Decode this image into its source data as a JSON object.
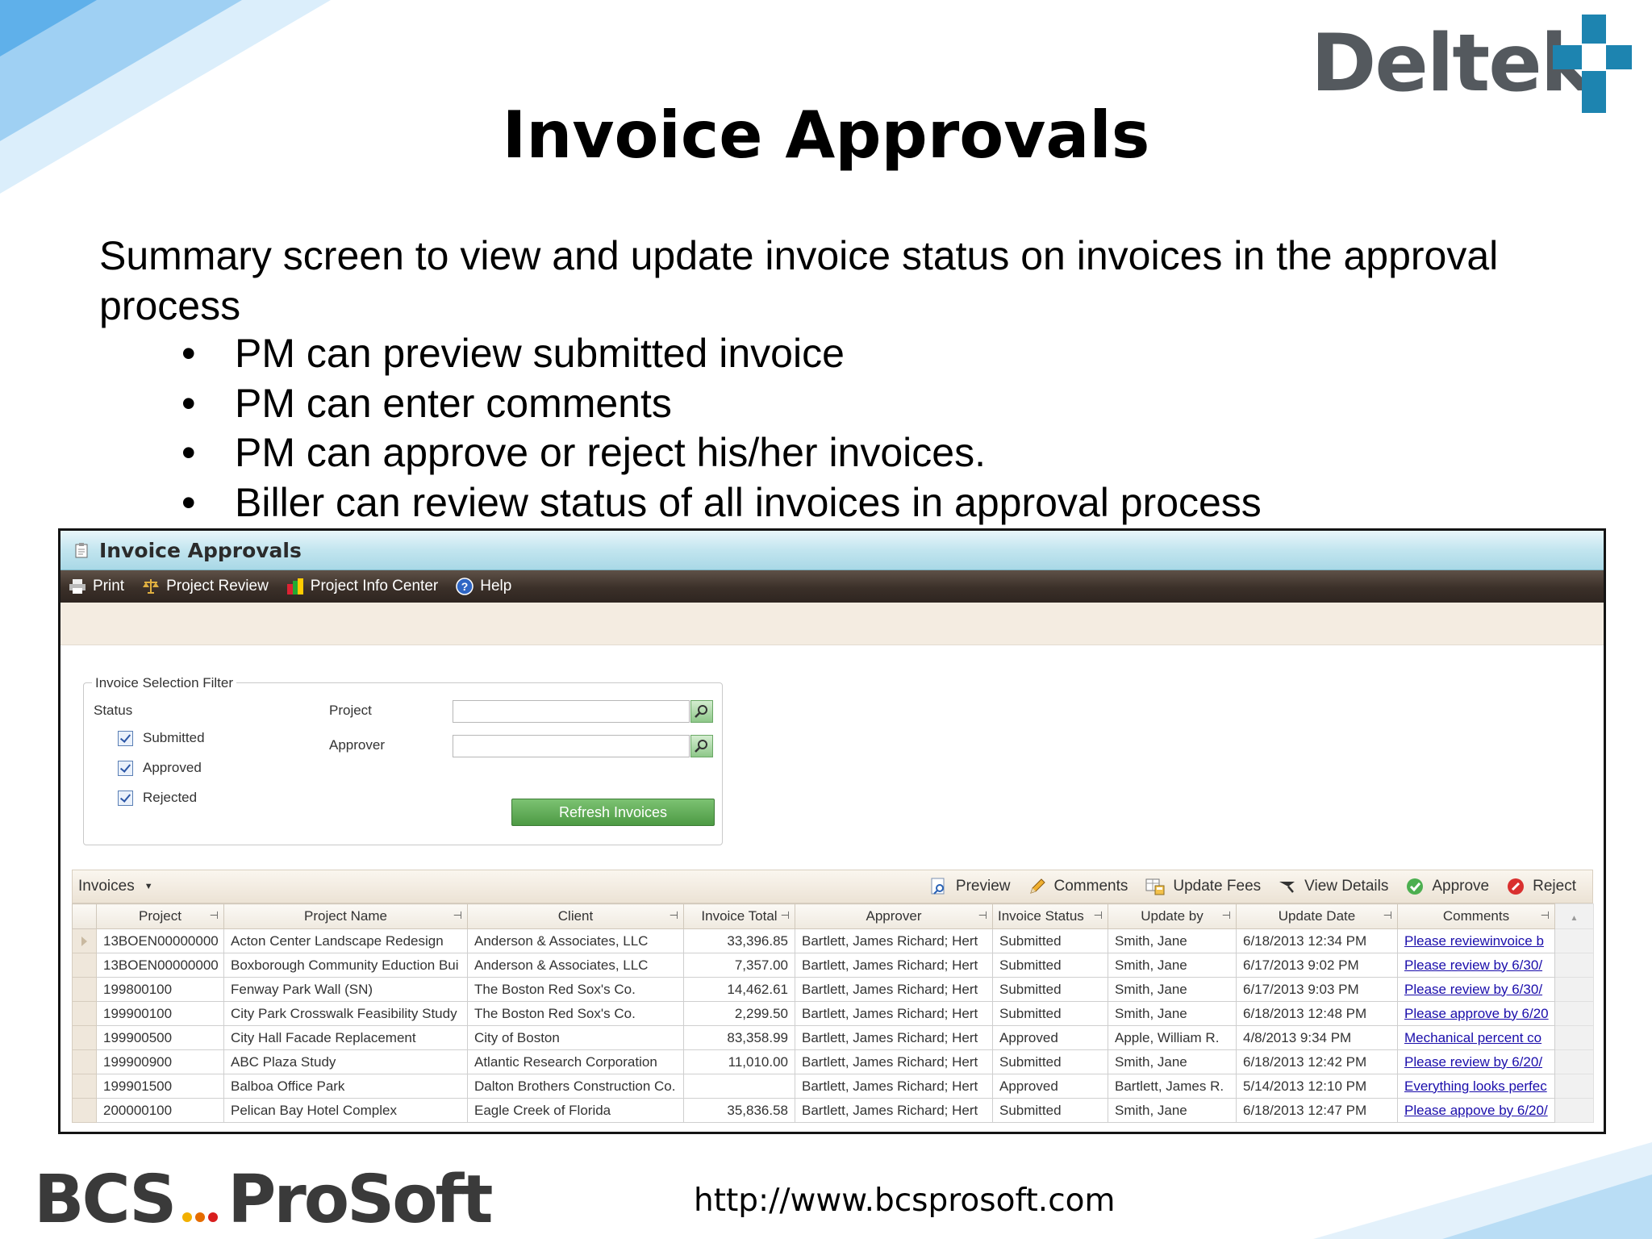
{
  "slide": {
    "title": "Invoice Approvals",
    "intro": "Summary screen to view and update invoice status on invoices in the approval process",
    "bullets": [
      "PM can preview submitted invoice",
      "PM can enter comments",
      "PM can approve or reject his/her invoices.",
      "Biller can review status of all invoices in approval process"
    ],
    "bullet_glyph": "•",
    "brand_top": "Deltek",
    "brand_bottom": "BCS ProSoft",
    "brand_bottom_parts": [
      "BCS",
      "ProSoft"
    ],
    "url": "http://www.bcsprosoft.com",
    "colors": {
      "deltek_blue": "#1d84b0",
      "deltek_gray": "#54595e",
      "dot_colors": [
        "#f2b000",
        "#e56c00",
        "#d81e1e"
      ]
    }
  },
  "app": {
    "window_title": "Invoice Approvals",
    "toolbar": {
      "print": "Print",
      "project_review": "Project Review",
      "project_info_center": "Project Info Center",
      "help": "Help"
    },
    "filter": {
      "legend": "Invoice Selection Filter",
      "status_label": "Status",
      "statuses": [
        {
          "label": "Submitted",
          "checked": true
        },
        {
          "label": "Approved",
          "checked": true
        },
        {
          "label": "Rejected",
          "checked": true
        }
      ],
      "project_label": "Project",
      "project_value": "",
      "approver_label": "Approver",
      "approver_value": "",
      "refresh_button": "Refresh Invoices"
    },
    "grid": {
      "title": "Invoices",
      "actions": {
        "preview": "Preview",
        "comments": "Comments",
        "update_fees": "Update Fees",
        "view_details": "View Details",
        "approve": "Approve",
        "reject": "Reject"
      },
      "columns": [
        "Project",
        "Project Name",
        "Client",
        "Invoice Total",
        "Approver",
        "Invoice Status",
        "Update by",
        "Update Date",
        "Comments"
      ],
      "rows": [
        [
          "13BOEN00000000",
          "Acton Center Landscape Redesign",
          "Anderson & Associates, LLC",
          "33,396.85",
          "Bartlett, James Richard; Hert",
          "Submitted",
          "Smith, Jane",
          "6/18/2013 12:34 PM",
          "Please reviewinvoice b"
        ],
        [
          "13BOEN00000000",
          "Boxborough Community Eduction Bui",
          "Anderson & Associates, LLC",
          "7,357.00",
          "Bartlett, James Richard; Hert",
          "Submitted",
          "Smith, Jane",
          "6/17/2013 9:02 PM",
          "Please review by 6/30/"
        ],
        [
          "199800100",
          "Fenway Park Wall (SN)",
          "The Boston Red Sox's Co.",
          "14,462.61",
          "Bartlett, James Richard; Hert",
          "Submitted",
          "Smith, Jane",
          "6/17/2013 9:03 PM",
          "Please review by 6/30/"
        ],
        [
          "199900100",
          "City Park Crosswalk Feasibility Study",
          "The Boston Red Sox's Co.",
          "2,299.50",
          "Bartlett, James Richard; Hert",
          "Submitted",
          "Smith, Jane",
          "6/18/2013 12:48 PM",
          "Please approve by 6/20"
        ],
        [
          "199900500",
          "City Hall Facade Replacement",
          "City of Boston",
          "83,358.99",
          "Bartlett, James Richard; Hert",
          "Approved",
          "Apple, William R.",
          "4/8/2013 9:34 PM",
          "Mechanical percent co"
        ],
        [
          "199900900",
          "ABC Plaza Study",
          "Atlantic Research Corporation",
          "11,010.00",
          "Bartlett, James Richard; Hert",
          "Submitted",
          "Smith, Jane",
          "6/18/2013 12:42 PM",
          "Please review by 6/20/"
        ],
        [
          "199901500",
          "Balboa Office Park",
          "Dalton Brothers Construction Co.",
          "",
          "Bartlett, James Richard; Hert",
          "Approved",
          "Bartlett, James R.",
          "5/14/2013 12:10 PM",
          "Everything looks perfec"
        ],
        [
          "200000100",
          "Pelican Bay Hotel Complex",
          "Eagle Creek of Florida",
          "35,836.58",
          "Bartlett, James Richard; Hert",
          "Submitted",
          "Smith, Jane",
          "6/18/2013 12:47 PM",
          "Please appove by 6/20/"
        ]
      ]
    }
  }
}
